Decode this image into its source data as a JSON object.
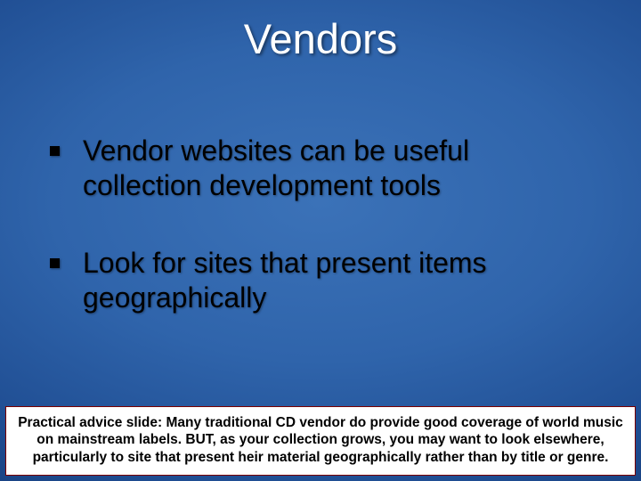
{
  "slide": {
    "title": "Vendors",
    "bullets": [
      {
        "text": "Vendor websites can be useful collection development tools"
      },
      {
        "text": "Look for sites that present items geographically"
      }
    ],
    "note": "Practical advice slide: Many traditional CD vendor do provide good coverage of world music on mainstream labels. BUT, as your collection grows, you may want to look elsewhere, particularly to site that present heir material geographically rather than by title or genre."
  }
}
